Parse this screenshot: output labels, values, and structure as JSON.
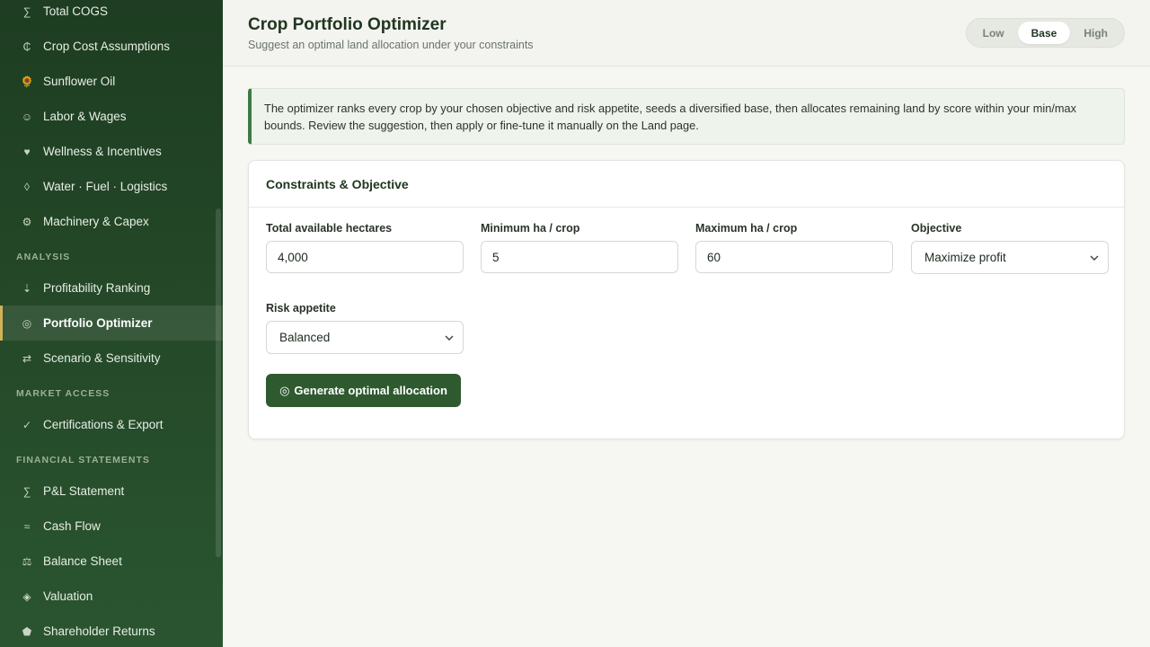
{
  "sidebar": {
    "items_top": [
      {
        "icon": "∑",
        "label": "Total COGS"
      },
      {
        "icon": "₵",
        "label": "Crop Cost Assumptions"
      },
      {
        "icon": "🌻",
        "label": "Sunflower Oil"
      },
      {
        "icon": "☺",
        "label": "Labor & Wages"
      },
      {
        "icon": "♥",
        "label": "Wellness & Incentives"
      },
      {
        "icon": "◊",
        "label": "Water · Fuel · Logistics"
      },
      {
        "icon": "⚙",
        "label": "Machinery & Capex"
      }
    ],
    "section_analysis": "ANALYSIS",
    "items_analysis": [
      {
        "icon": "⇣",
        "label": "Profitability Ranking"
      },
      {
        "icon": "◎",
        "label": "Portfolio Optimizer"
      },
      {
        "icon": "⇄",
        "label": "Scenario & Sensitivity"
      }
    ],
    "section_market": "MARKET ACCESS",
    "items_market": [
      {
        "icon": "✓",
        "label": "Certifications & Export"
      }
    ],
    "section_financial": "FINANCIAL STATEMENTS",
    "items_financial": [
      {
        "icon": "∑",
        "label": "P&L Statement"
      },
      {
        "icon": "≈",
        "label": "Cash Flow"
      },
      {
        "icon": "⚖",
        "label": "Balance Sheet"
      },
      {
        "icon": "◈",
        "label": "Valuation"
      },
      {
        "icon": "⬟",
        "label": "Shareholder Returns"
      }
    ]
  },
  "header": {
    "title": "Crop Portfolio Optimizer",
    "subtitle": "Suggest an optimal land allocation under your constraints",
    "scenario": {
      "low": "Low",
      "base": "Base",
      "high": "High",
      "selected": "Base"
    }
  },
  "info": {
    "text": "The optimizer ranks every crop by your chosen objective and risk appetite, seeds a diversified base, then allocates remaining land by score within your min/max bounds. Review the suggestion, then apply or fine-tune it manually on the Land page."
  },
  "form": {
    "title": "Constraints & Objective",
    "total_label": "Total available hectares",
    "total_value": "4,000",
    "min_label": "Minimum ha / crop",
    "min_value": "5",
    "max_label": "Maximum ha / crop",
    "max_value": "60",
    "objective_label": "Objective",
    "objective_value": "Maximize profit",
    "risk_label": "Risk appetite",
    "risk_value": "Balanced",
    "generate_icon": "◎",
    "generate_label": "Generate optimal allocation"
  }
}
